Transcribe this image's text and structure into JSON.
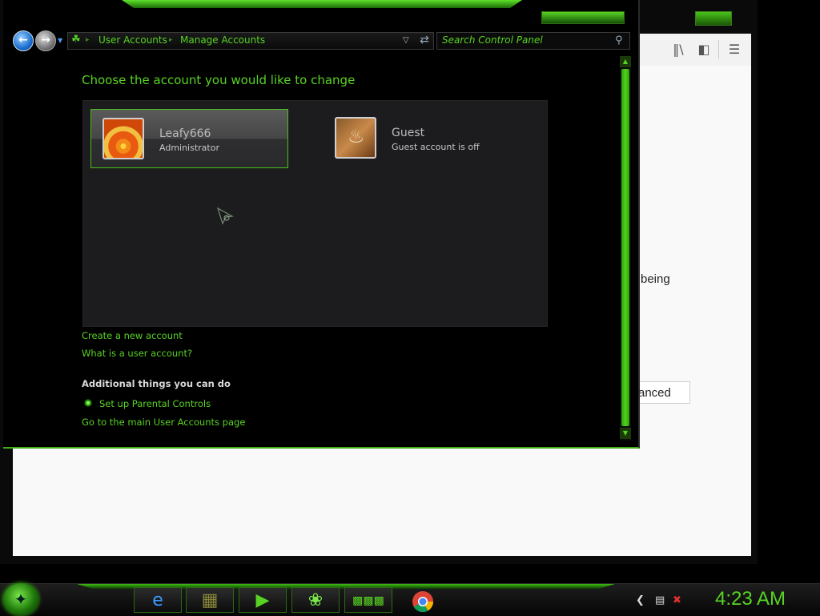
{
  "browser_bg": {
    "text_being": "being",
    "button_fragment": "anced",
    "toolbar_icons": [
      "library-icon",
      "sidebar-icon",
      "menu-icon"
    ]
  },
  "explorer": {
    "breadcrumb": [
      "User Accounts",
      "Manage Accounts"
    ],
    "search_placeholder": "Search Control Panel",
    "heading": "Choose the account you would like to change",
    "accounts": [
      {
        "name": "Leafy666",
        "role": "Administrator",
        "selected": true
      },
      {
        "name": "Guest",
        "role": "Guest account is off",
        "selected": false
      }
    ],
    "links": {
      "create": "Create a new account",
      "what_is": "What is a user account?"
    },
    "additional_heading": "Additional things you can do",
    "parental": "Set up Parental Controls",
    "main_page": "Go to the main User Accounts page"
  },
  "taskbar": {
    "apps": [
      "internet-explorer",
      "file-manager",
      "media-player",
      "network-globe",
      "desktop-gadgets",
      "chrome"
    ],
    "clock": "4:23 AM"
  },
  "colors": {
    "accent": "#58d323",
    "window_bg": "#000000",
    "panel_bg": "#1c1c1e"
  }
}
